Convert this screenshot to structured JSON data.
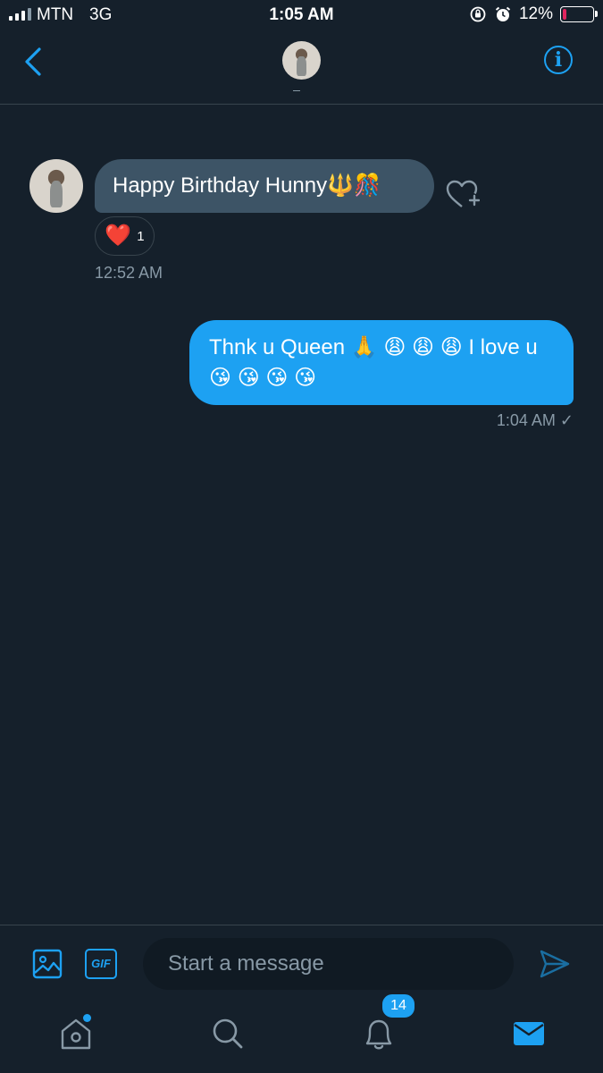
{
  "status_bar": {
    "carrier": "MTN",
    "network": "3G",
    "time": "1:05 AM",
    "battery": "12%",
    "battery_level": 0.12
  },
  "conversation": {
    "messages": [
      {
        "direction": "incoming",
        "text": "Happy Birthday Hunny🔱🎊",
        "reaction": {
          "emoji": "❤️",
          "count": "1"
        },
        "time": "12:52 AM"
      },
      {
        "direction": "outgoing",
        "text": "Thnk u Queen 🙏 😩 😩 😩 I love u😘 😘 😘 😘",
        "time": "1:04 AM ✓"
      }
    ]
  },
  "composer": {
    "gif_label": "GIF",
    "placeholder": "Start a message"
  },
  "tabbar": {
    "notifications_count": "14"
  },
  "colors": {
    "background": "#15202b",
    "accent": "#1da1f2",
    "incoming_bubble": "#3d5466",
    "muted_text": "#8899a6",
    "divider": "#38444d"
  },
  "icons": {
    "back": "chevron-left-icon",
    "info": "info-icon",
    "react": "heart-plus-icon",
    "media": "image-icon",
    "send": "send-icon",
    "home": "home-icon",
    "search": "search-icon",
    "notifications": "bell-icon",
    "messages": "mail-icon"
  }
}
